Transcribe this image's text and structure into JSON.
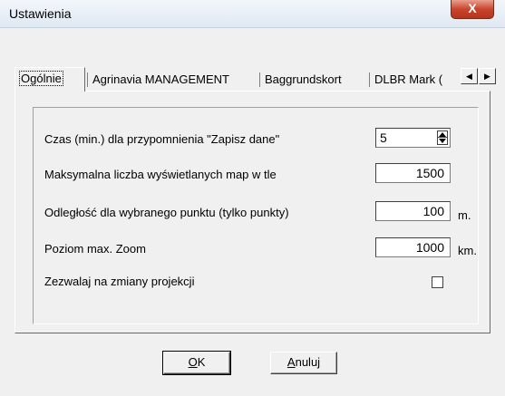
{
  "window": {
    "title": "Ustawienia",
    "close_glyph": "X"
  },
  "tabs": [
    {
      "label": "Ogólnie",
      "active": true
    },
    {
      "label": "Agrinavia MANAGEMENT",
      "active": false
    },
    {
      "label": "Baggrundskort",
      "active": false
    },
    {
      "label": "DLBR Mark (",
      "active": false
    }
  ],
  "tab_scroll": {
    "left_glyph": "◀",
    "right_glyph": "▶"
  },
  "settings": {
    "reminder": {
      "label": "Czas (min.) dla przypomnienia \"Zapisz dane\"",
      "value": "5"
    },
    "max_maps": {
      "label": "Maksymalna liczba wyświetlanych map w tle",
      "value": "1500"
    },
    "distance": {
      "label": "Odległość dla wybranego punktu (tylko punkty)",
      "value": "100",
      "unit": "m."
    },
    "max_zoom": {
      "label": "Poziom max. Zoom",
      "value": "1000",
      "unit": "km."
    },
    "projection": {
      "label": "Zezwalaj na zmiany projekcji",
      "checked": false
    }
  },
  "buttons": {
    "ok_accel": "O",
    "ok_rest": "K",
    "cancel_accel": "A",
    "cancel_rest": "nuluj"
  }
}
